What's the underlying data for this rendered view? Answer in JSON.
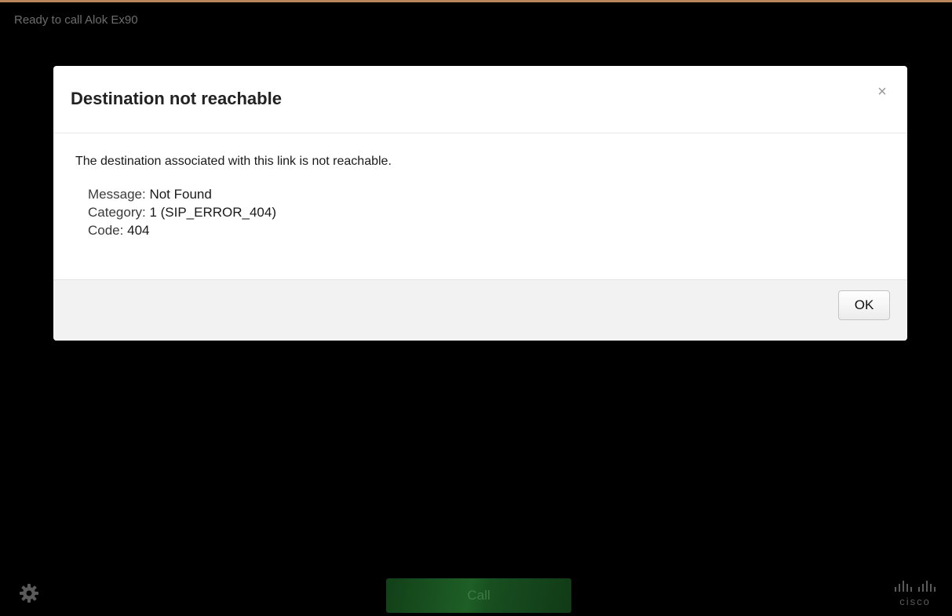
{
  "status": {
    "text": "Ready to call Alok Ex90"
  },
  "dialog": {
    "title": "Destination not reachable",
    "close_glyph": "×",
    "message": "The destination associated with this link is not reachable.",
    "details": [
      {
        "key": "Message:",
        "value": "Not Found"
      },
      {
        "key": "Category:",
        "value": "1 (SIP_ERROR_404)"
      },
      {
        "key": "Code:",
        "value": "404"
      }
    ],
    "ok_label": "OK"
  },
  "toolbar": {
    "settings_icon": "gear-icon",
    "call_label": "Call",
    "logo_text": "cisco"
  },
  "colors": {
    "background": "#000000",
    "call_button": "#1e5f26",
    "status_text": "#6d6d6d"
  }
}
